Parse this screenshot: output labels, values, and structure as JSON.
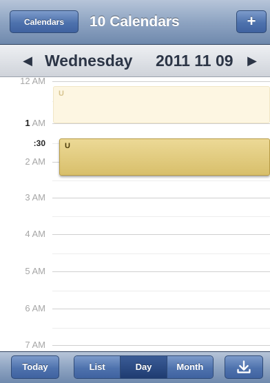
{
  "navbar": {
    "calendars_label": "Calendars",
    "title": "10 Calendars",
    "add_label": "+"
  },
  "datebar": {
    "prev_icon": "◀",
    "weekday": "Wednesday",
    "date": "2011 11 09",
    "next_icon": "▶"
  },
  "grid": {
    "hours": [
      {
        "label": "12 AM",
        "bold": ""
      },
      {
        "label": "AM",
        "bold": "1"
      },
      {
        "label": "2 AM",
        "bold": ""
      },
      {
        "label": "3 AM",
        "bold": ""
      },
      {
        "label": "4 AM",
        "bold": ""
      },
      {
        "label": "5 AM",
        "bold": ""
      },
      {
        "label": "6 AM",
        "bold": ""
      },
      {
        "label": "7 AM",
        "bold": ""
      }
    ],
    "half_label": ":30",
    "events": {
      "faded_title": "U",
      "active_title": "U"
    }
  },
  "toolbar": {
    "today_label": "Today",
    "segments": [
      "List",
      "Day",
      "Month"
    ],
    "selected_segment": "Day",
    "download_icon": "download-icon"
  },
  "colors": {
    "bar_blue": "#6f89ad",
    "button_blue": "#4e72ad",
    "event_gold": "#d8bf6b",
    "event_faded": "#fdf6e2"
  }
}
